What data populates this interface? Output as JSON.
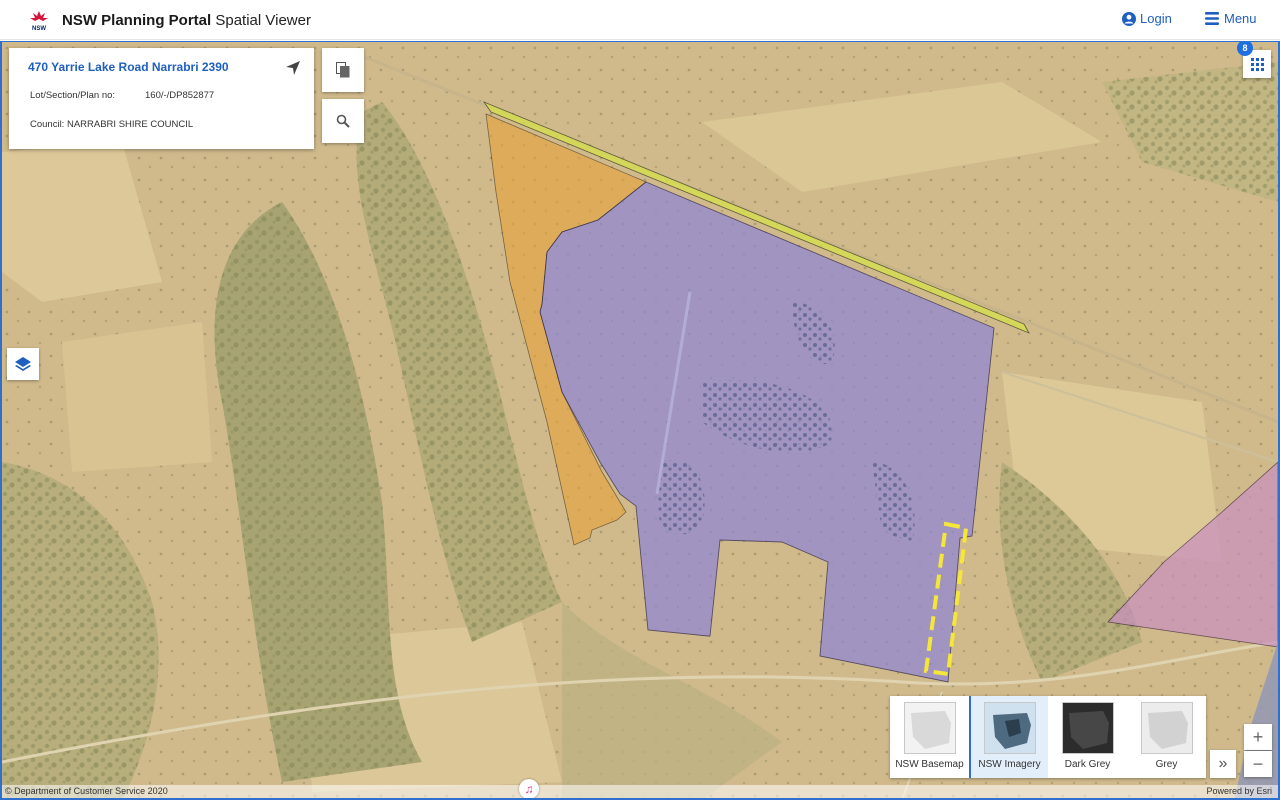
{
  "header": {
    "logo_text": "NSW",
    "title_bold": "NSW Planning Portal",
    "title_rest": " Spatial Viewer",
    "login_label": "Login",
    "menu_label": "Menu"
  },
  "property": {
    "address": "470 Yarrie Lake Road Narrabri 2390",
    "lot_label": "Lot/Section/Plan no:",
    "lot_value": "160/-/DP852877",
    "council": "Council: NARRABRI SHIRE COUNCIL"
  },
  "apps_badge": "8",
  "basemaps": [
    {
      "label": "NSW Basemap",
      "active": false
    },
    {
      "label": "NSW Imagery",
      "active": true
    },
    {
      "label": "Dark Grey",
      "active": false
    },
    {
      "label": "Grey",
      "active": false
    }
  ],
  "controls": {
    "expand": "»",
    "zoom_in": "+",
    "zoom_out": "−"
  },
  "attribution": {
    "left": "© Department of Customer Service 2020",
    "right": "Powered by Esri"
  },
  "colors": {
    "accent": "#1f5fbf",
    "lot_purple": "#8f86d6",
    "orange_zone": "#e8a23a",
    "yellow_corridor": "#d7e14a",
    "pink_zone": "#c98fc0",
    "dashed_outline": "#f5e63a"
  },
  "icons": [
    "nsw-waratah-logo",
    "user-icon",
    "hamburger-icon",
    "locate-arrow-icon",
    "copy-icon",
    "search-icon",
    "layers-icon",
    "apps-grid-icon",
    "music-icon"
  ]
}
